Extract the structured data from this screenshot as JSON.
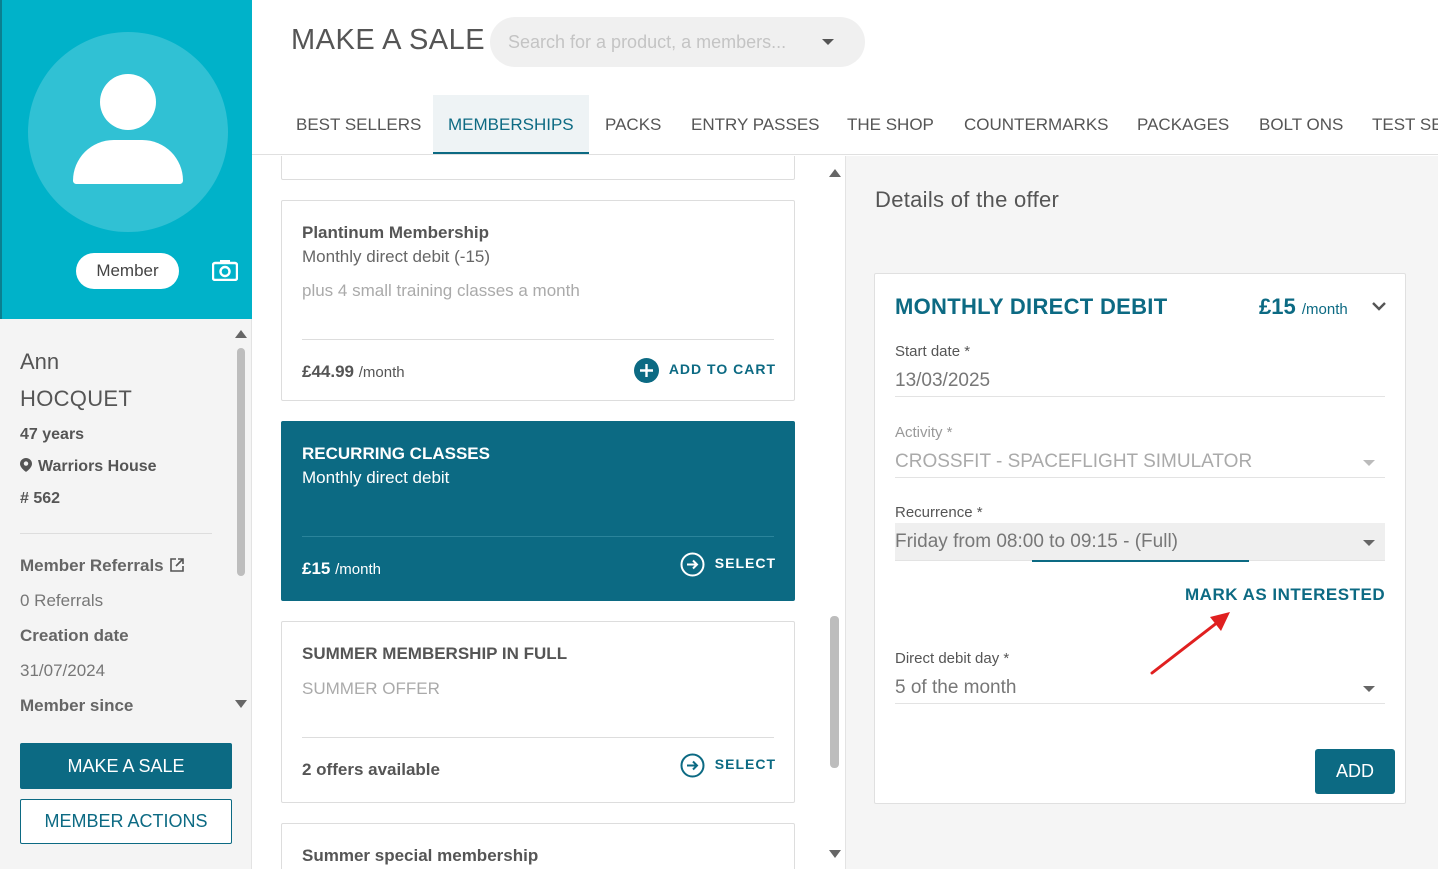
{
  "sidebar": {
    "badge": "Member",
    "first_name": "Ann",
    "last_name": "HOCQUET",
    "age": "47 years",
    "location": "Warriors House",
    "member_number": "# 562",
    "referrals_label": "Member Referrals",
    "referrals_value": "0 Referrals",
    "creation_label": "Creation date",
    "creation_value": "31/07/2024",
    "member_since_label": "Member since",
    "make_sale_button": "MAKE A SALE",
    "member_actions_button": "MEMBER ACTIONS"
  },
  "header": {
    "title": "MAKE A SALE",
    "search_placeholder": "Search for a product, a members..."
  },
  "tabs": [
    "BEST SELLERS",
    "MEMBERSHIPS",
    "PACKS",
    "ENTRY PASSES",
    "THE SHOP",
    "COUNTERMARKS",
    "PACKAGES",
    "BOLT ONS",
    "TEST SE"
  ],
  "active_tab": "MEMBERSHIPS",
  "cards": [
    {
      "title": "Plantinum Membership",
      "subtitle": "Monthly direct debit (-15)",
      "description": "plus 4 small training classes a month",
      "price": "£44.99",
      "price_unit": "/month",
      "action": "ADD TO CART"
    },
    {
      "title": "RECURRING CLASSES",
      "subtitle": "Monthly direct debit",
      "price": "£15",
      "price_unit": "/month",
      "action": "SELECT"
    },
    {
      "title": "SUMMER MEMBERSHIP IN FULL",
      "description": "SUMMER OFFER",
      "price": "2 offers available",
      "action": "SELECT"
    },
    {
      "title": "Summer special membership"
    }
  ],
  "details": {
    "title": "Details of the offer",
    "offer_name": "MONTHLY DIRECT DEBIT",
    "offer_price": "£15",
    "offer_price_unit": "/month",
    "start_date_label": "Start date *",
    "start_date_value": "13/03/2025",
    "activity_label": "Activity *",
    "activity_value": "CROSSFIT - SPACEFLIGHT SIMULATOR",
    "recurrence_label": "Recurrence *",
    "recurrence_value": "Friday from 08:00 to 09:15 - (Full)",
    "mark_interested": "MARK AS INTERESTED",
    "debit_day_label": "Direct debit day *",
    "debit_day_value": "5 of the month",
    "add_button": "ADD"
  },
  "colors": {
    "accent": "#0c6a83",
    "sidebar_top": "#00b2c9",
    "annotation_arrow": "#e02020"
  }
}
